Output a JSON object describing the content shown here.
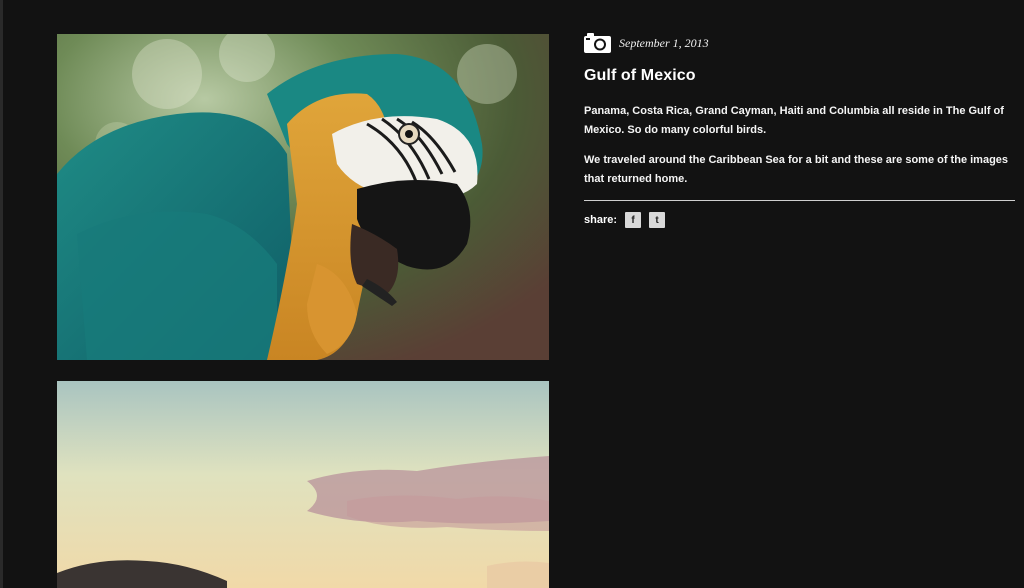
{
  "post": {
    "date": "September 1, 2013",
    "title": "Gulf of Mexico",
    "paragraphs": [
      "Panama, Costa Rica, Grand Cayman, Haiti and Columbia all reside in The Gulf of Mexico. So do many colorful birds.",
      "We traveled around the Caribbean Sea for a bit and these are some of the images that returned home."
    ],
    "share_label": "share:",
    "share_facebook": "f",
    "share_twitter": "t",
    "icon": "camera-icon"
  },
  "images": [
    {
      "subject": "macaw-parrot-photo"
    },
    {
      "subject": "sunset-sky-photo"
    }
  ],
  "colors": {
    "background": "#121212",
    "text": "#ffffff",
    "share_button": "#d9d9d9"
  }
}
